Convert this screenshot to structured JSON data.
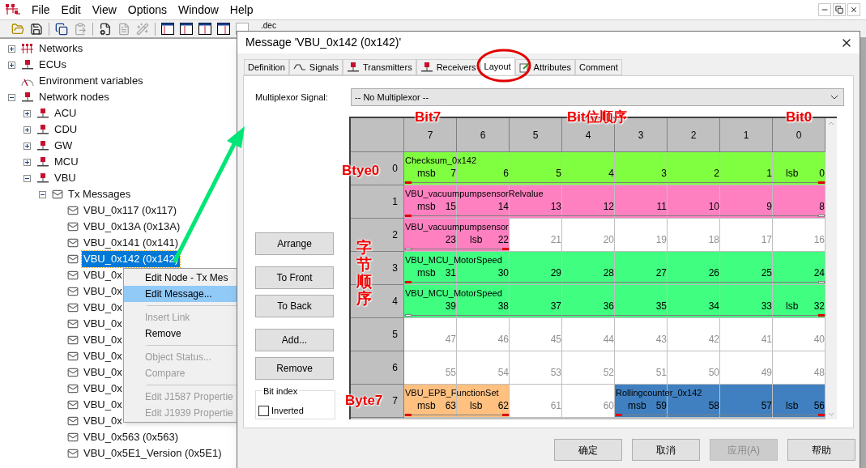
{
  "menu_bar": {
    "items": [
      "File",
      "Edit",
      "View",
      "Options",
      "Window",
      "Help"
    ]
  },
  "toolbar": {
    "label": ".dec"
  },
  "tree": [
    {
      "label": "Networks",
      "kind": "network",
      "expanded": false,
      "selected": false
    },
    {
      "label": "ECUs",
      "kind": "node",
      "expanded": false,
      "selected": false
    },
    {
      "label": "Environment variables",
      "kind": "gauge",
      "selected": false
    },
    {
      "label": "Network nodes",
      "kind": "node",
      "expanded": true,
      "selected": false,
      "children": [
        {
          "label": "ACU",
          "kind": "node",
          "expanded": false,
          "selected": false
        },
        {
          "label": "CDU",
          "kind": "node",
          "expanded": false,
          "selected": false
        },
        {
          "label": "GW",
          "kind": "node",
          "expanded": false,
          "selected": false
        },
        {
          "label": "MCU",
          "kind": "node",
          "expanded": false,
          "selected": false
        },
        {
          "label": "VBU",
          "kind": "node",
          "expanded": true,
          "selected": false,
          "children": [
            {
              "label": "Tx Messages",
              "kind": "message",
              "expanded": true,
              "selected": false,
              "children": [
                {
                  "label": "VBU_0x117 (0x117)",
                  "kind": "message",
                  "selected": false
                },
                {
                  "label": "VBU_0x13A (0x13A)",
                  "kind": "message",
                  "selected": false
                },
                {
                  "label": "VBU_0x141 (0x141)",
                  "kind": "message",
                  "selected": false
                },
                {
                  "label": "VBU_0x142 (0x142)",
                  "kind": "message",
                  "selected": true
                },
                {
                  "label": "VBU_0x",
                  "kind": "message",
                  "selected": false
                },
                {
                  "label": "VBU_0x",
                  "kind": "message",
                  "selected": false
                },
                {
                  "label": "VBU_0x",
                  "kind": "message",
                  "selected": false
                },
                {
                  "label": "VBU_0x",
                  "kind": "message",
                  "selected": false
                },
                {
                  "label": "VBU_0x",
                  "kind": "message",
                  "selected": false
                },
                {
                  "label": "VBU_0x",
                  "kind": "message",
                  "selected": false
                },
                {
                  "label": "VBU_0x",
                  "kind": "message",
                  "selected": false
                },
                {
                  "label": "VBU_0x",
                  "kind": "message",
                  "selected": false
                },
                {
                  "label": "VBU_0x",
                  "kind": "message",
                  "selected": false
                },
                {
                  "label": "VBU_0x",
                  "kind": "message",
                  "selected": false
                },
                {
                  "label": "VBU_0x563 (0x563)",
                  "kind": "message",
                  "selected": false
                },
                {
                  "label": "VBU_0x5E1_Version (0x5E1)",
                  "kind": "message",
                  "selected": false
                }
              ]
            }
          ]
        }
      ]
    }
  ],
  "context_menu": [
    {
      "kind": "item",
      "label": "Edit Node - Tx Mes",
      "disabled": false,
      "selected": false
    },
    {
      "kind": "item",
      "label": "Edit Message...",
      "disabled": false,
      "selected": true
    },
    {
      "kind": "separator"
    },
    {
      "kind": "item",
      "label": "Insert Link",
      "disabled": true,
      "selected": false
    },
    {
      "kind": "item",
      "label": "Remove",
      "disabled": false,
      "selected": false
    },
    {
      "kind": "separator"
    },
    {
      "kind": "item",
      "label": "Object Status...",
      "disabled": true,
      "selected": false
    },
    {
      "kind": "item",
      "label": "Compare",
      "disabled": true,
      "selected": false
    },
    {
      "kind": "separator"
    },
    {
      "kind": "item",
      "label": "Edit J1587 Propertie",
      "disabled": true,
      "selected": false
    },
    {
      "kind": "item",
      "label": "Edit J1939 Propertie",
      "disabled": true,
      "selected": false
    }
  ],
  "dialog": {
    "title": "Message 'VBU_0x142 (0x142)'",
    "tabs": [
      {
        "label": "Definition",
        "kind": "plain",
        "selected": false
      },
      {
        "label": "Signals",
        "kind": "signal",
        "selected": false
      },
      {
        "label": "Transmitters",
        "kind": "node",
        "selected": false
      },
      {
        "label": "Receivers",
        "kind": "node",
        "selected": false
      },
      {
        "label": "Layout",
        "kind": "plain",
        "selected": true
      },
      {
        "label": "Attributes",
        "kind": "edit",
        "selected": false
      },
      {
        "label": "Comment",
        "kind": "plain",
        "selected": false
      }
    ],
    "multiplexor": {
      "label": "Multiplexor Signal:",
      "value": "-- No Multiplexor --"
    },
    "side_buttons": [
      [
        "Arrange"
      ],
      [
        "To Front",
        "To Back"
      ],
      [
        "Add...",
        "Remove"
      ]
    ],
    "bit_index": {
      "title": "Bit index",
      "option": "Inverted",
      "checked": false
    },
    "layout": {
      "columns": [
        "7",
        "6",
        "5",
        "4",
        "3",
        "2",
        "1",
        "0"
      ],
      "rows": [
        {
          "byte": "0",
          "segments": [
            {
              "name": "Checksum_0x142",
              "color": "#80ff40",
              "bits": [
                {
                  "number": "7",
                  "tag": "msb"
                },
                {
                  "number": "6"
                },
                {
                  "number": "5"
                },
                {
                  "number": "4"
                },
                {
                  "number": "3"
                },
                {
                  "number": "2"
                },
                {
                  "number": "1"
                },
                {
                  "number": "0",
                  "tag": "lsb"
                }
              ]
            }
          ]
        },
        {
          "byte": "1",
          "segments": [
            {
              "name": "VBU_vacuumpumpsensorRelvalue",
              "color": "#ff80c0",
              "bits": [
                {
                  "number": "15",
                  "tag": "msb"
                },
                {
                  "number": "14"
                },
                {
                  "number": "13"
                },
                {
                  "number": "12"
                },
                {
                  "number": "11"
                },
                {
                  "number": "10"
                },
                {
                  "number": "9"
                },
                {
                  "number": "8"
                }
              ]
            }
          ]
        },
        {
          "byte": "2",
          "segments": [
            {
              "name": "VBU_vacuumpumpsensor",
              "color": "#ff80c0",
              "bits": [
                {
                  "number": "23"
                },
                {
                  "number": "22",
                  "tag": "lsb"
                }
              ]
            },
            {
              "bits": [
                {
                  "number": "21"
                },
                {
                  "number": "20"
                },
                {
                  "number": "19"
                },
                {
                  "number": "18"
                },
                {
                  "number": "17"
                },
                {
                  "number": "16"
                }
              ]
            }
          ]
        },
        {
          "byte": "3",
          "segments": [
            {
              "name": "VBU_MCU_MotorSpeed",
              "color": "#40ff80",
              "bits": [
                {
                  "number": "31",
                  "tag": "msb"
                },
                {
                  "number": "30"
                },
                {
                  "number": "29"
                },
                {
                  "number": "28"
                },
                {
                  "number": "27"
                },
                {
                  "number": "26"
                },
                {
                  "number": "25"
                },
                {
                  "number": "24"
                }
              ]
            }
          ]
        },
        {
          "byte": "4",
          "segments": [
            {
              "name": "VBU_MCU_MotorSpeed",
              "color": "#40ff80",
              "bits": [
                {
                  "number": "39"
                },
                {
                  "number": "38"
                },
                {
                  "number": "37"
                },
                {
                  "number": "36"
                },
                {
                  "number": "35"
                },
                {
                  "number": "34"
                },
                {
                  "number": "33"
                },
                {
                  "number": "32",
                  "tag": "lsb"
                }
              ]
            }
          ]
        },
        {
          "byte": "5",
          "segments": [
            {
              "bits": [
                {
                  "number": "47"
                },
                {
                  "number": "46"
                },
                {
                  "number": "45"
                },
                {
                  "number": "44"
                },
                {
                  "number": "43"
                },
                {
                  "number": "42"
                },
                {
                  "number": "41"
                },
                {
                  "number": "40"
                }
              ]
            }
          ]
        },
        {
          "byte": "6",
          "segments": [
            {
              "bits": [
                {
                  "number": "55"
                },
                {
                  "number": "54"
                },
                {
                  "number": "53"
                },
                {
                  "number": "52"
                },
                {
                  "number": "51"
                },
                {
                  "number": "50"
                },
                {
                  "number": "49"
                },
                {
                  "number": "48"
                }
              ]
            }
          ]
        },
        {
          "byte": "7",
          "segments": [
            {
              "name": "VBU_EPB_FunctionSet",
              "color": "#ffc080",
              "bits": [
                {
                  "number": "63",
                  "tag": "msb"
                },
                {
                  "number": "62",
                  "tag": "lsb"
                }
              ]
            },
            {
              "bits": [
                {
                  "number": "61"
                },
                {
                  "number": "60"
                }
              ]
            },
            {
              "name": "Rollingcounter_0x142",
              "color": "#4080c0",
              "bits": [
                {
                  "number": "59",
                  "tag": "msb"
                },
                {
                  "number": "58"
                },
                {
                  "number": "57"
                },
                {
                  "number": "56",
                  "tag": "lsb"
                }
              ]
            }
          ]
        }
      ]
    },
    "buttons": [
      {
        "label": "确定",
        "disabled": false
      },
      {
        "label": "取消",
        "disabled": false
      },
      {
        "label": "应用(A)",
        "disabled": true
      },
      {
        "label": "帮助",
        "disabled": false
      }
    ]
  },
  "annotations": [
    {
      "text": "Bit7",
      "kind": "horizontal"
    },
    {
      "text": "Bit位顺序",
      "kind": "horizontal"
    },
    {
      "text": "Bit0",
      "kind": "horizontal"
    },
    {
      "text": "Btye0",
      "kind": "horizontal"
    },
    {
      "text": "字节顺序",
      "kind": "vertical"
    },
    {
      "text": "Byte7",
      "kind": "horizontal"
    }
  ]
}
